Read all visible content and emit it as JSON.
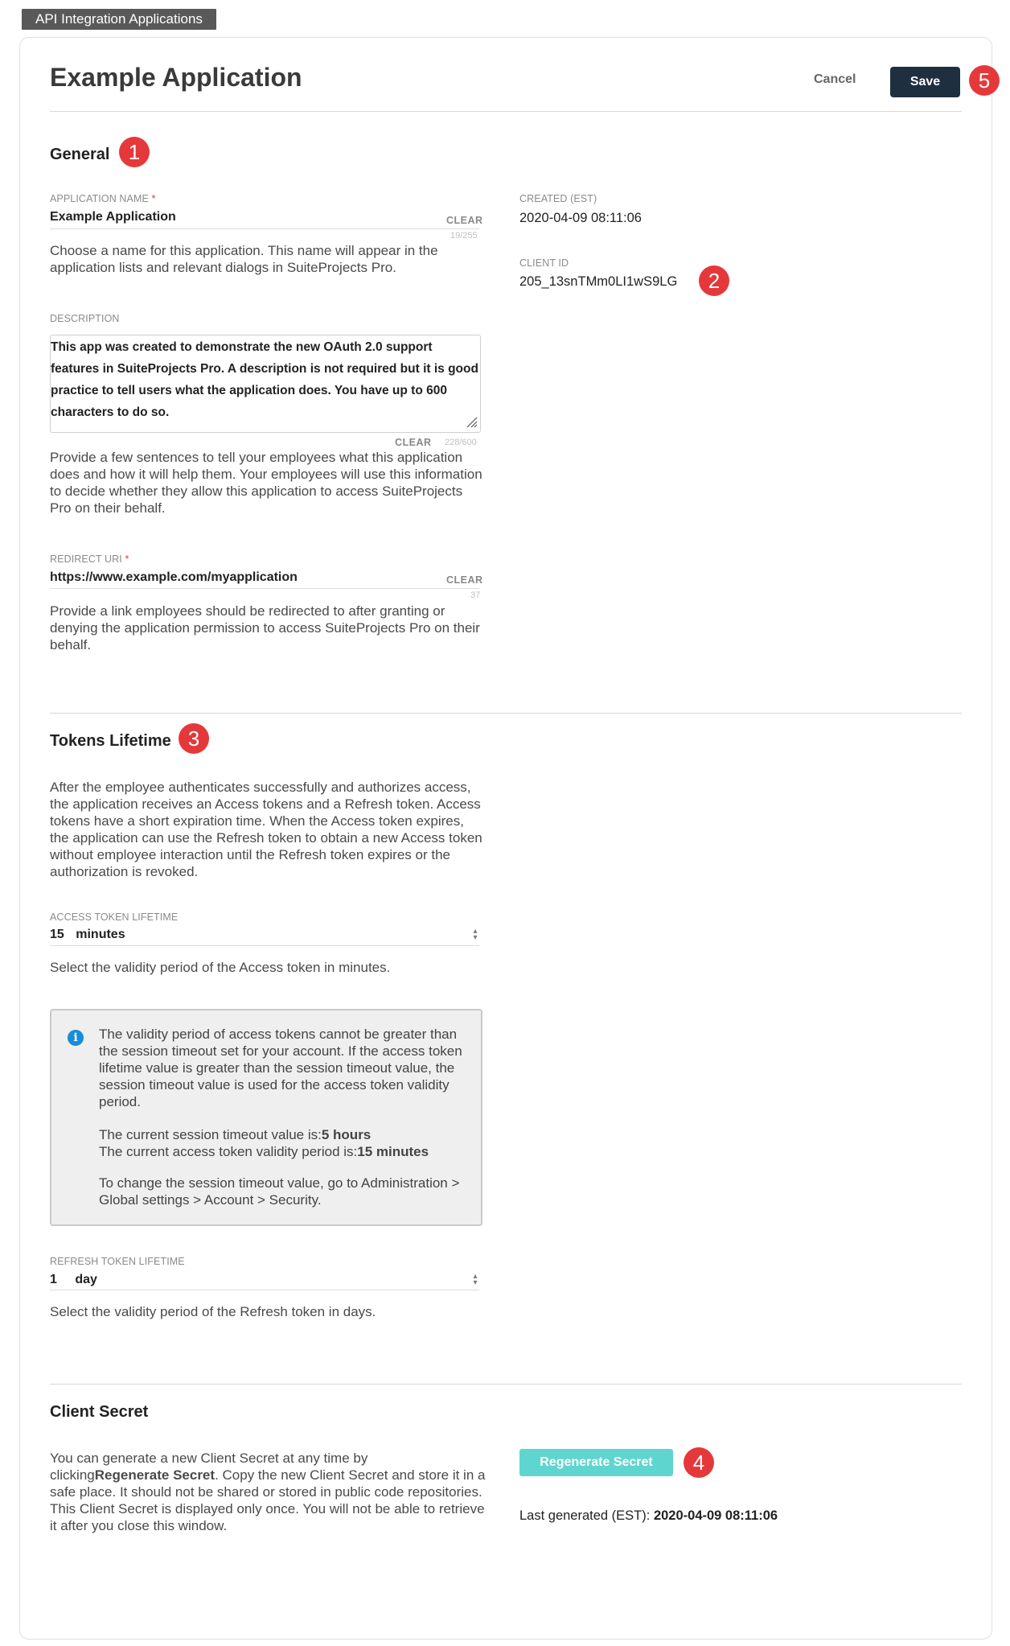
{
  "tab": {
    "label": "API Integration Applications"
  },
  "header": {
    "title": "Example Application",
    "cancel_label": "Cancel",
    "save_label": "Save"
  },
  "badges": {
    "b1": "1",
    "b2": "2",
    "b3": "3",
    "b4": "4",
    "b5": "5"
  },
  "general": {
    "heading": "General",
    "app_name": {
      "label": "APPLICATION NAME",
      "required": "*",
      "value": "Example Application",
      "clear": "CLEAR",
      "count": "19/255",
      "help": "Choose a name for this application. This name will appear in the application lists and relevant dialogs in SuiteProjects Pro."
    },
    "description": {
      "label": "DESCRIPTION",
      "value": "This app was created to demonstrate the new OAuth 2.0 support features in SuiteProjects Pro. A description is not required but it is good practice to tell  users what the application does. You have up to 600 characters to do so.",
      "clear": "CLEAR",
      "count": "228/600",
      "help": "Provide a few sentences to tell your employees what this application does and how it will help them. Your employees will use this information to decide whether they allow this application to access SuiteProjects Pro on their behalf."
    },
    "redirect": {
      "label": "REDIRECT URI",
      "required": "*",
      "value": "https://www.example.com/myapplication",
      "clear": "CLEAR",
      "count": "37",
      "help": "Provide a link employees should be redirected to after granting or denying the application permission to access SuiteProjects Pro on their behalf."
    },
    "created": {
      "label": "CREATED (EST)",
      "value": "2020-04-09 08:11:06"
    },
    "client_id": {
      "label": "CLIENT ID",
      "value": "205_13snTMm0LI1wS9LG"
    }
  },
  "tokens": {
    "heading": "Tokens Lifetime",
    "intro": "After the employee authenticates successfully and authorizes access, the application receives an Access tokens and a Refresh token. Access tokens have a short expiration time. When the Access token expires, the application can use the Refresh token to obtain a new Access token without employee interaction until the Refresh token expires or the authorization is revoked.",
    "access": {
      "label": "ACCESS TOKEN LIFETIME",
      "value": "15",
      "unit": "minutes",
      "help": "Select the validity period of the Access token in minutes."
    },
    "info": {
      "icon": "info-icon",
      "p1": "The validity period of access tokens cannot be greater than the session timeout set for your account. If the access token lifetime value is greater than the session timeout value, the session timeout value is used for the access token validity period.",
      "session_prefix": "The current session timeout value is:",
      "session_value": "5 hours",
      "access_prefix": "The current access token validity period is:",
      "access_value": "15 minutes",
      "p3": "To change the session timeout value, go to Administration > Global settings > Account > Security."
    },
    "refresh": {
      "label": "REFRESH TOKEN LIFETIME",
      "value": "1",
      "unit": "day",
      "help": "Select the validity period of the Refresh token in days."
    }
  },
  "secret": {
    "heading": "Client Secret",
    "text_before": "You can generate a new Client Secret at any time by clicking",
    "text_bold": "Regenerate Secret",
    "text_after": ". Copy the new Client Secret and store it in a safe place. It should not be shared or stored in public code repositories. This Client Secret is displayed only once. You will not be able to retrieve it after you close this window.",
    "button": "Regenerate Secret",
    "last_label": "Last generated (EST):",
    "last_value": "2020-04-09 08:11:06"
  },
  "colors": {
    "accent_dark": "#1e2f3f",
    "badge_red": "#e5383b",
    "regen_teal": "#5ed6cf",
    "info_blue": "#1a8cd8"
  }
}
